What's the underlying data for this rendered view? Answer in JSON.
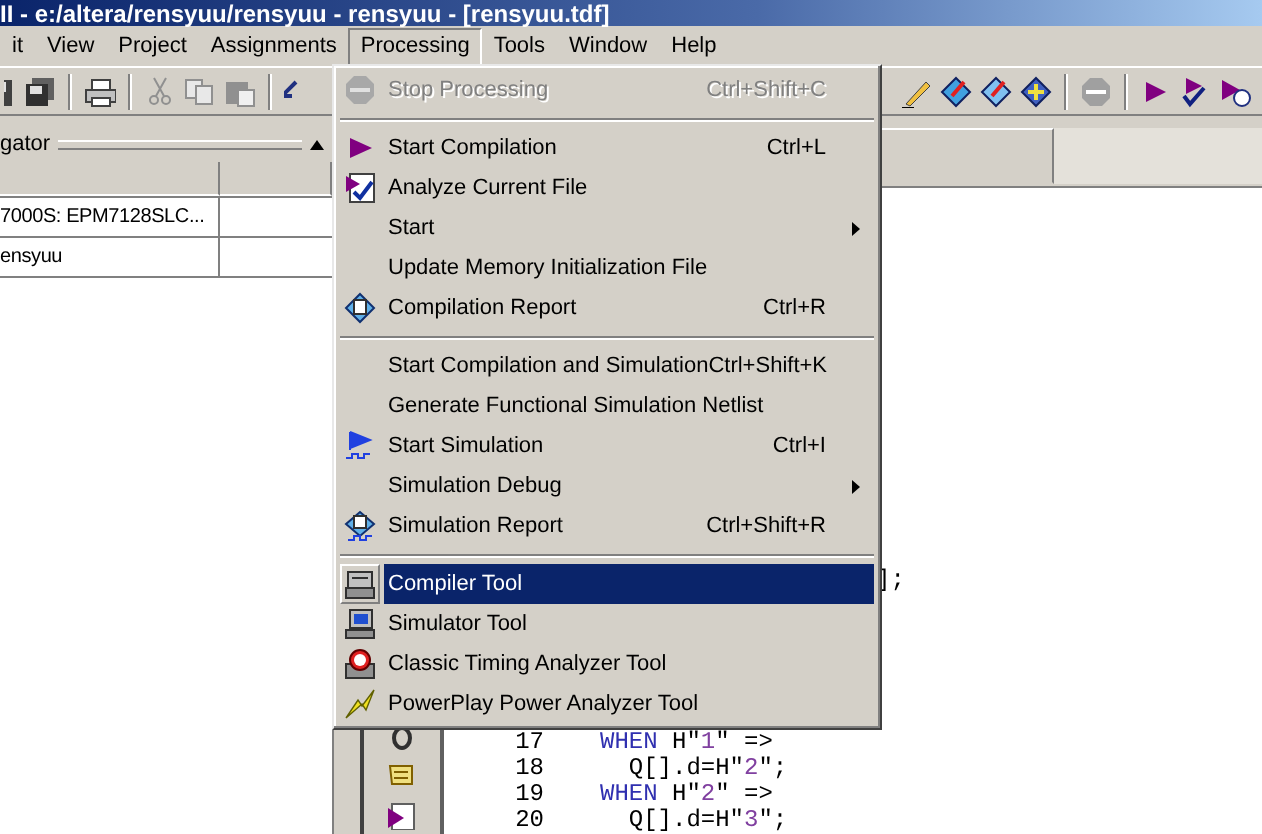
{
  "window": {
    "title": "II - e:/altera/rensyuu/rensyuu - rensyuu - [rensyuu.tdf]"
  },
  "menu_bar": [
    {
      "label": "it",
      "selected": false
    },
    {
      "label": "View",
      "selected": false
    },
    {
      "label": "Project",
      "selected": false
    },
    {
      "label": "Assignments",
      "selected": false
    },
    {
      "label": "Processing",
      "selected": true
    },
    {
      "label": "Tools",
      "selected": false
    },
    {
      "label": "Window",
      "selected": false
    },
    {
      "label": "Help",
      "selected": false
    }
  ],
  "navigator": {
    "title": "gator",
    "rows": [
      "7000S: EPM7128SLC...",
      "ensyuu"
    ]
  },
  "processing_menu": [
    {
      "kind": "command",
      "label": "Stop Processing",
      "shortcut": "Ctrl+Shift+C",
      "disabled": true,
      "selected": false,
      "submenu": false
    },
    {
      "kind": "separator"
    },
    {
      "kind": "command",
      "label": "Start Compilation",
      "shortcut": "Ctrl+L",
      "disabled": false,
      "selected": false,
      "submenu": false
    },
    {
      "kind": "command",
      "label": "Analyze Current File",
      "disabled": false,
      "selected": false,
      "submenu": false
    },
    {
      "kind": "command",
      "label": "Start",
      "disabled": false,
      "selected": false,
      "submenu": true
    },
    {
      "kind": "command",
      "label": "Update Memory Initialization File",
      "disabled": false,
      "selected": false,
      "submenu": false
    },
    {
      "kind": "command",
      "label": "Compilation Report",
      "shortcut": "Ctrl+R",
      "disabled": false,
      "selected": false,
      "submenu": false
    },
    {
      "kind": "separator"
    },
    {
      "kind": "command",
      "label": "Start Compilation and Simulation",
      "shortcut": "Ctrl+Shift+K",
      "disabled": false,
      "selected": false,
      "submenu": false
    },
    {
      "kind": "command",
      "label": "Generate Functional Simulation Netlist",
      "disabled": false,
      "selected": false,
      "submenu": false
    },
    {
      "kind": "command",
      "label": "Start Simulation",
      "shortcut": "Ctrl+I",
      "disabled": false,
      "selected": false,
      "submenu": false
    },
    {
      "kind": "command",
      "label": "Simulation Debug",
      "disabled": false,
      "selected": false,
      "submenu": true
    },
    {
      "kind": "command",
      "label": "Simulation Report",
      "shortcut": "Ctrl+Shift+R",
      "disabled": false,
      "selected": false,
      "submenu": false
    },
    {
      "kind": "separator"
    },
    {
      "kind": "command",
      "label": "Compiler Tool",
      "disabled": false,
      "selected": true,
      "submenu": false
    },
    {
      "kind": "command",
      "label": "Simulator Tool",
      "disabled": false,
      "selected": false,
      "submenu": false
    },
    {
      "kind": "command",
      "label": "Classic Timing Analyzer Tool",
      "disabled": false,
      "selected": false,
      "submenu": false
    },
    {
      "kind": "command",
      "label": "PowerPlay Power Analyzer Tool",
      "disabled": false,
      "selected": false,
      "submenu": false
    }
  ],
  "editor": {
    "fragment": "];",
    "lines": [
      {
        "number": "17",
        "tokens": [
          {
            "kind": "keyword",
            "text": "WHEN"
          },
          {
            "kind": "plain",
            "text": " H\""
          },
          {
            "kind": "string",
            "text": "1"
          },
          {
            "kind": "plain",
            "text": "\" =>"
          }
        ]
      },
      {
        "number": "18",
        "tokens": [
          {
            "kind": "plain",
            "text": "  Q[].d=H\""
          },
          {
            "kind": "string",
            "text": "2"
          },
          {
            "kind": "plain",
            "text": "\";"
          }
        ]
      },
      {
        "number": "19",
        "tokens": [
          {
            "kind": "keyword",
            "text": "WHEN"
          },
          {
            "kind": "plain",
            "text": " H\""
          },
          {
            "kind": "string",
            "text": "2"
          },
          {
            "kind": "plain",
            "text": "\" =>"
          }
        ]
      },
      {
        "number": "20",
        "tokens": [
          {
            "kind": "plain",
            "text": "  Q[].d=H\""
          },
          {
            "kind": "string",
            "text": "3"
          },
          {
            "kind": "plain",
            "text": "\";"
          }
        ]
      }
    ]
  }
}
